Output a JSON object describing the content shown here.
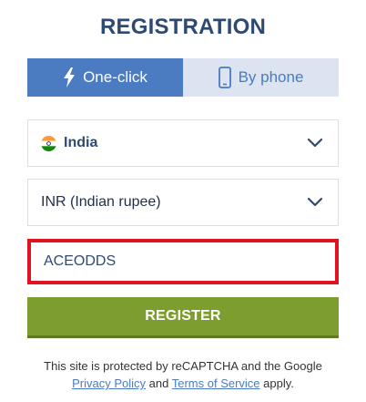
{
  "header": {
    "title": "REGISTRATION"
  },
  "tabs": [
    {
      "label": "One-click",
      "icon": "lightning-icon",
      "active": true
    },
    {
      "label": "By phone",
      "icon": "phone-icon",
      "active": false
    }
  ],
  "form": {
    "country": {
      "value": "India",
      "icon": "india-flag-icon"
    },
    "currency": {
      "value": "INR (Indian rupee)"
    },
    "promo_code": {
      "value": "ACEODDS"
    },
    "register_label": "REGISTER"
  },
  "footer": {
    "line1": "This site is protected by reCAPTCHA and the Google",
    "privacy_link": "Privacy Policy",
    "and_text": "and",
    "terms_link": "Terms of Service",
    "apply_text": "apply."
  },
  "colors": {
    "title": "#2e4a72",
    "tab_active_bg": "#4b7bc0",
    "tab_inactive_bg": "#dbe4f0",
    "promo_border": "#e0141e",
    "register_bg": "#7d9e2f",
    "link": "#4b7bc0"
  }
}
